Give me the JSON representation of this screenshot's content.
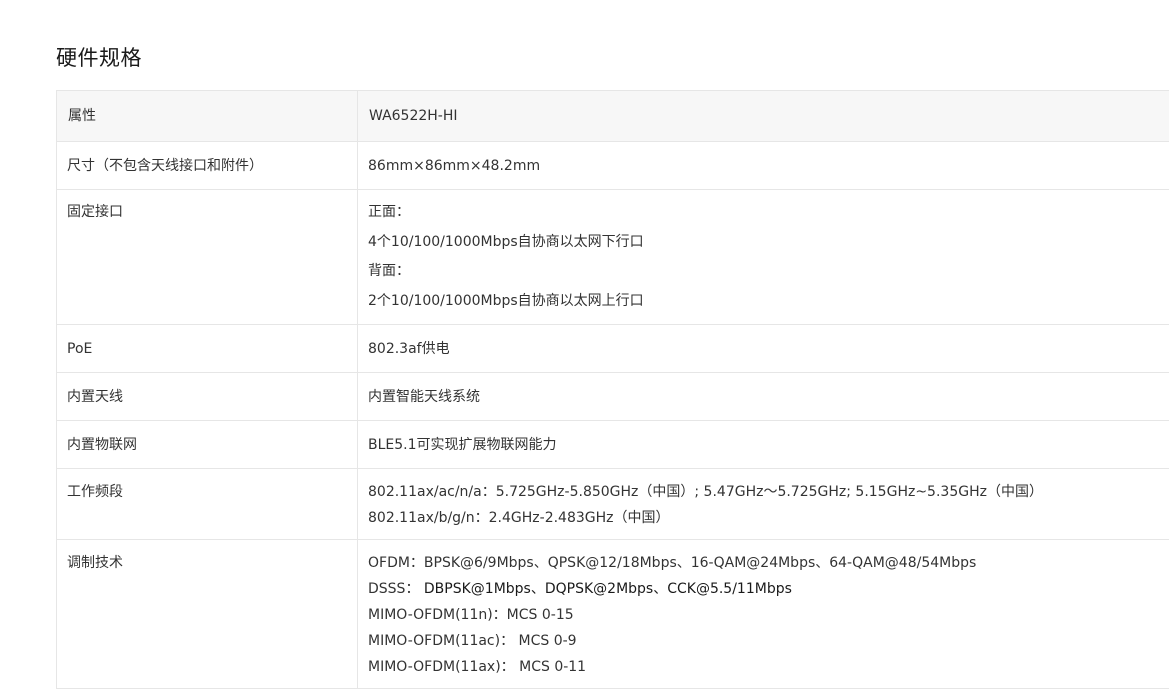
{
  "section": {
    "title": "硬件规格"
  },
  "table": {
    "header": {
      "attribute": "属性",
      "model": "WA6522H-HI"
    },
    "rows": [
      {
        "name": "尺寸（不包含天线接口和附件）",
        "values": [
          "86mm×86mm×48.2mm"
        ]
      },
      {
        "name": "固定接口",
        "values": [
          "正面：",
          "4个10/100/1000Mbps自协商以太网下行口",
          "背面：",
          "2个10/100/1000Mbps自协商以太网上行口"
        ]
      },
      {
        "name": "PoE",
        "values": [
          "802.3af供电"
        ]
      },
      {
        "name": "内置天线",
        "values": [
          "内置智能天线系统"
        ]
      },
      {
        "name": "内置物联网",
        "values": [
          "BLE5.1可实现扩展物联网能力"
        ]
      },
      {
        "name": "工作频段",
        "values": [
          "802.11ax/ac/n/a：5.725GHz-5.850GHz（中国）; 5.47GHz～5.725GHz; 5.15GHz~5.35GHz（中国）",
          "802.11ax/b/g/n：2.4GHz-2.483GHz（中国）"
        ]
      },
      {
        "name": "调制技术",
        "values": [
          "OFDM：BPSK@6/9Mbps、QPSK@12/18Mbps、16-QAM@24Mbps、64-QAM@48/54Mbps",
          "DSSS：",
          "DBPSK@1Mbps、DQPSK@2Mbps、CCK@5.5/11Mbps",
          "MIMO-OFDM(11n)：MCS 0-15",
          "MIMO-OFDM(11ac)：  MCS 0-9",
          "MIMO-OFDM(11ax)：  MCS 0-11"
        ]
      }
    ]
  }
}
